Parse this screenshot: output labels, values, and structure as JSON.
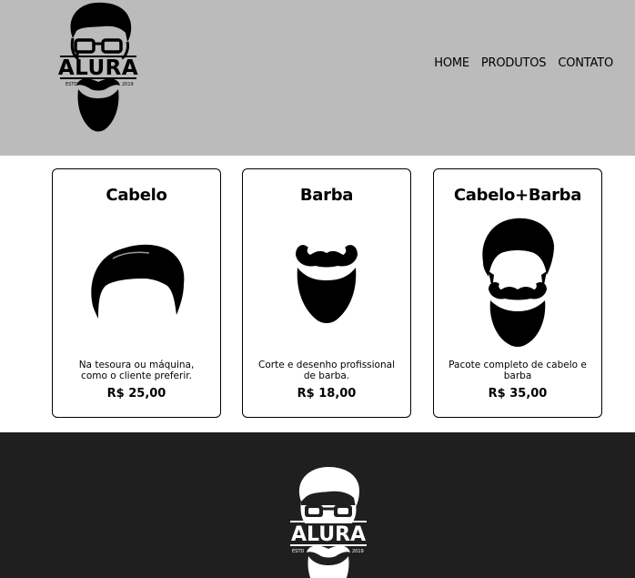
{
  "header": {
    "logo": {
      "icon": "alura-barber-logo",
      "brand": "ALURA",
      "estd": "ESTD",
      "year": "2019"
    },
    "nav": [
      {
        "label": "HOME"
      },
      {
        "label": "PRODUTOS"
      },
      {
        "label": "CONTATO"
      }
    ]
  },
  "products": [
    {
      "title": "Cabelo",
      "icon": "hair-icon",
      "description": "Na tesoura ou máquina, como o cliente preferir.",
      "price": "R$ 25,00"
    },
    {
      "title": "Barba",
      "icon": "beard-icon",
      "description": "Corte e desenho profissional de barba.",
      "price": "R$ 18,00"
    },
    {
      "title": "Cabelo+Barba",
      "icon": "hair-beard-icon",
      "description": "Pacote completo de cabelo e barba",
      "price": "R$ 35,00"
    }
  ],
  "footer": {
    "logo": {
      "icon": "alura-barber-logo",
      "brand": "ALURA",
      "estd": "ESTD",
      "year": "2019"
    }
  },
  "colors": {
    "header_bg": "#bbbbbb",
    "footer_bg": "#1f1f1f",
    "text": "#000000"
  }
}
